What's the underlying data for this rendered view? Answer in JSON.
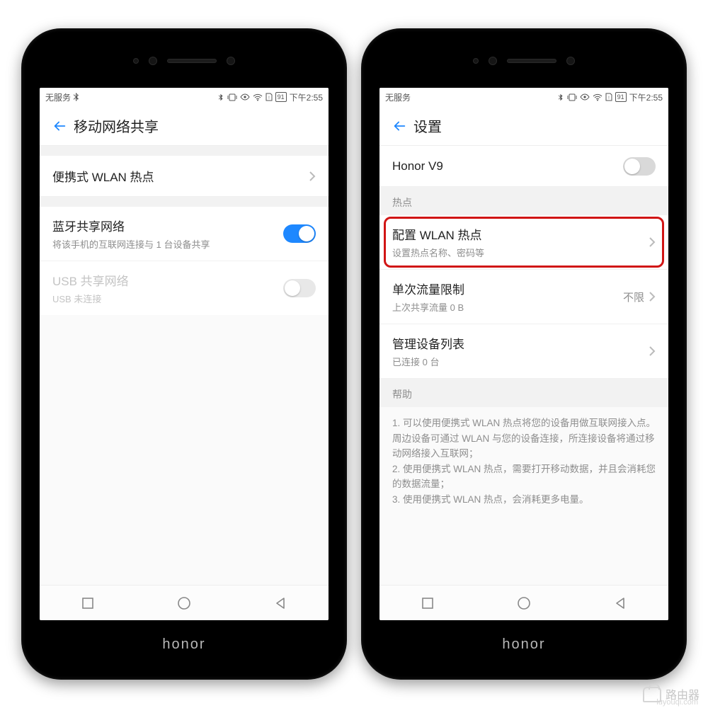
{
  "status": {
    "carrier": "无服务",
    "battery": "91",
    "clock": "下午2:55"
  },
  "brand": "honor",
  "left": {
    "title": "移动网络共享",
    "rows": {
      "hotspot": {
        "title": "便携式 WLAN 热点"
      },
      "bluetooth": {
        "title": "蓝牙共享网络",
        "sub": "将该手机的互联网连接与 1 台设备共享"
      },
      "usb": {
        "title": "USB 共享网络",
        "sub": "USB 未连接"
      }
    }
  },
  "right": {
    "title": "设置",
    "device_row": {
      "title": "Honor V9"
    },
    "section_hotspot": "热点",
    "rows": {
      "config": {
        "title": "配置 WLAN 热点",
        "sub": "设置热点名称、密码等"
      },
      "limit": {
        "title": "单次流量限制",
        "sub": "上次共享流量 0 B",
        "value": "不限"
      },
      "manage": {
        "title": "管理设备列表",
        "sub": "已连接 0 台"
      }
    },
    "section_help": "帮助",
    "help": {
      "l1": "1. 可以使用便携式 WLAN 热点将您的设备用做互联网接入点。周边设备可通过 WLAN 与您的设备连接，所连接设备将通过移动网络接入互联网；",
      "l2": "2. 使用便携式 WLAN 热点，需要打开移动数据，并且会消耗您的数据流量；",
      "l3": "3. 使用便携式 WLAN 热点，会消耗更多电量。"
    }
  },
  "watermark": {
    "text": "路由器",
    "sub": "luyouqi.com"
  }
}
